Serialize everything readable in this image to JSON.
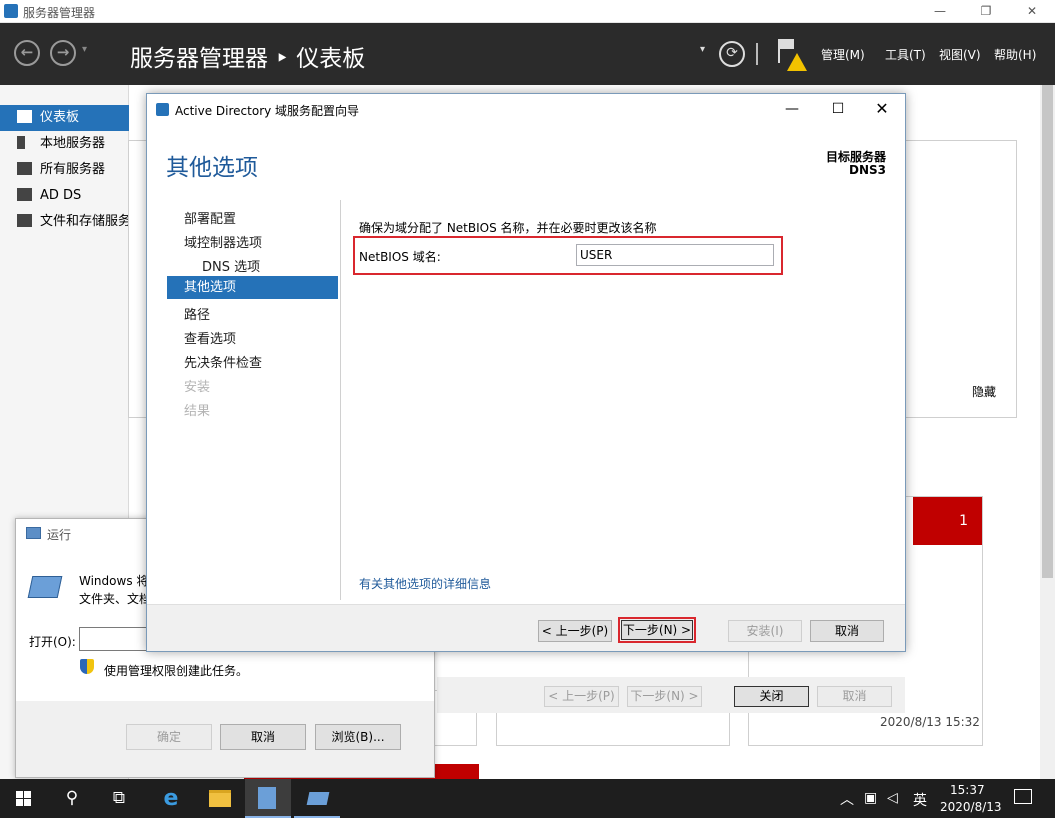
{
  "window": {
    "title": "服务器管理器"
  },
  "header": {
    "title": "服务器管理器 ‣ 仪表板",
    "menus": [
      "管理(M)",
      "工具(T)",
      "视图(V)",
      "帮助(H)"
    ]
  },
  "sidebar": {
    "items": [
      {
        "label": "仪表板",
        "icon": "dashboard-icon",
        "selected": true
      },
      {
        "label": "本地服务器",
        "icon": "server-icon"
      },
      {
        "label": "所有服务器",
        "icon": "servers-icon"
      },
      {
        "label": "AD DS",
        "icon": "adds-icon"
      },
      {
        "label": "文件和存储服务",
        "icon": "storage-icon"
      }
    ]
  },
  "dashboard": {
    "hide_label": "隐藏",
    "tile_count": "1",
    "timestamp": "2020/8/13 15:32",
    "back_btn": "< 上一步(P)",
    "next_btn": "下一步(N) >",
    "close_btn": "关闭",
    "cancel_btn": "取消"
  },
  "run": {
    "title": "运行",
    "desc_line1": "Windows 将",
    "desc_line2": "文件夹、文档",
    "open_label": "打开(O):",
    "input_value": "",
    "admin_note": "使用管理权限创建此任务。",
    "ok_btn": "确定",
    "cancel_btn": "取消",
    "browse_btn": "浏览(B)..."
  },
  "wizard": {
    "title": "Active Directory 域服务配置向导",
    "page_title": "其他选项",
    "target_label": "目标服务器",
    "target_value": "DNS3",
    "steps": [
      {
        "label": "部署配置",
        "state": "normal"
      },
      {
        "label": "域控制器选项",
        "state": "normal"
      },
      {
        "label": "DNS 选项",
        "state": "normal"
      },
      {
        "label": "其他选项",
        "state": "selected"
      },
      {
        "label": "路径",
        "state": "normal"
      },
      {
        "label": "查看选项",
        "state": "normal"
      },
      {
        "label": "先决条件检查",
        "state": "normal"
      },
      {
        "label": "安装",
        "state": "disabled"
      },
      {
        "label": "结果",
        "state": "disabled"
      }
    ],
    "instruction": "确保为域分配了 NetBIOS 名称，并在必要时更改该名称",
    "netbios_label": "NetBIOS 域名:",
    "netbios_value": "USER",
    "more_info_link": "有关其他选项的详细信息",
    "back_btn": "< 上一步(P)",
    "next_btn": "下一步(N) >",
    "install_btn": "安装(I)",
    "cancel_btn": "取消"
  },
  "taskbar": {
    "time": "15:37",
    "date": "2020/8/13",
    "ime": "英"
  },
  "colors": {
    "accent": "#2572b8",
    "header": "#2b2b2b",
    "alert": "#c00000",
    "highlight_border": "#d9272e"
  }
}
